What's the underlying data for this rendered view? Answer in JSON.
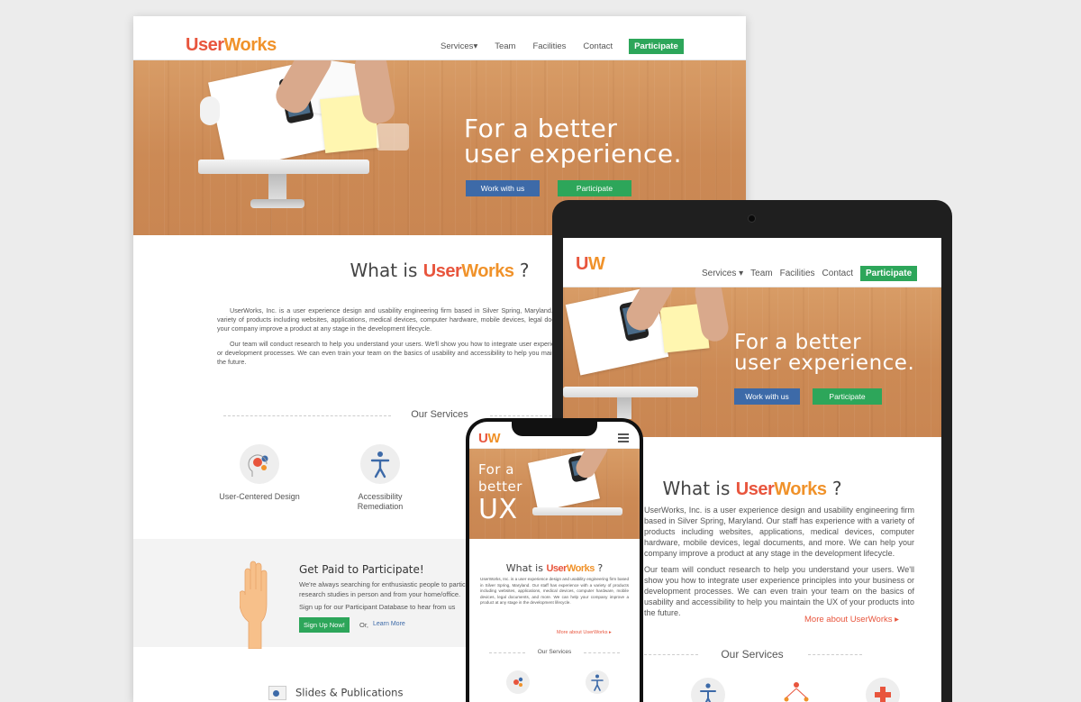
{
  "brand": {
    "part1": "User",
    "part2": "Works",
    "mark": "U",
    "mark2": "W"
  },
  "desktop": {
    "nav": {
      "services": "Services",
      "team": "Team",
      "facilities": "Facilities",
      "contact": "Contact",
      "participate": "Participate"
    },
    "hero": {
      "line1": "For a better",
      "line2": "user experience.",
      "work_btn": "Work with us",
      "participate_btn": "Participate"
    },
    "what": {
      "prefix": "What is",
      "suffix": "?"
    },
    "para1": "UserWorks, Inc. is a user experience design and usability engineering firm based in Silver Spring, Maryland. Our staff has experience with a variety of products including websites, applications, medical devices, computer hardware, mobile devices, legal documents, and more. We can help your company improve a product at any stage in the development lifecycle.",
    "para2": "Our team will conduct research to help you understand your users. We'll show you how to integrate user experience principles into your business or development processes. We can even train your team on the basics of usability and accessibility to help you maintain the UX of your products into the future.",
    "services_title": "Our Services",
    "services": [
      "User-Centered Design",
      "Accessibility Remediation"
    ],
    "paid": {
      "title": "Get Paid to Participate!",
      "p1": "We're always searching for enthusiastic people to participate in research studies in person and from your home/office.",
      "p2": "Sign up for our Participant Database to hear from us",
      "signup": "Sign Up Now!",
      "or": "Or,",
      "learn": "Learn More"
    },
    "slides": "Slides & Publications"
  },
  "tablet": {
    "nav": {
      "services": "Services",
      "team": "Team",
      "facilities": "Facilities",
      "contact": "Contact",
      "participate": "Participate"
    },
    "hero": {
      "line1": "For a better",
      "line2": "user experience.",
      "work_btn": "Work with us",
      "participate_btn": "Participate"
    },
    "para1": "UserWorks, Inc. is a user experience design and usability engineering firm based in Silver Spring, Maryland. Our staff has experience with a variety of products including websites, applications, medical devices, computer hardware, mobile devices, legal documents, and more. We can help your company improve a product at any stage in the development lifecycle.",
    "para2": "Our team will conduct research to help you understand your users. We'll show you how to integrate user experience principles into your business or development processes. We can even train your team on the basics of usability and accessibility to help you maintain the UX of your products into the future.",
    "more": "More about UserWorks",
    "services_title": "Our Services"
  },
  "phone": {
    "hero": {
      "line1": "For a",
      "line2": "better",
      "line3": "UX"
    },
    "para1": "UserWorks, Inc. is a user experience design and usability engineering firm based in Silver Spring, Maryland. Our staff has experience with a variety of products including websites, applications, medical devices, computer hardware, mobile devices, legal documents, and more. We can help your company improve a product at any stage in the development lifecycle.",
    "more": "More about UserWorks",
    "services_title": "Our Services"
  }
}
